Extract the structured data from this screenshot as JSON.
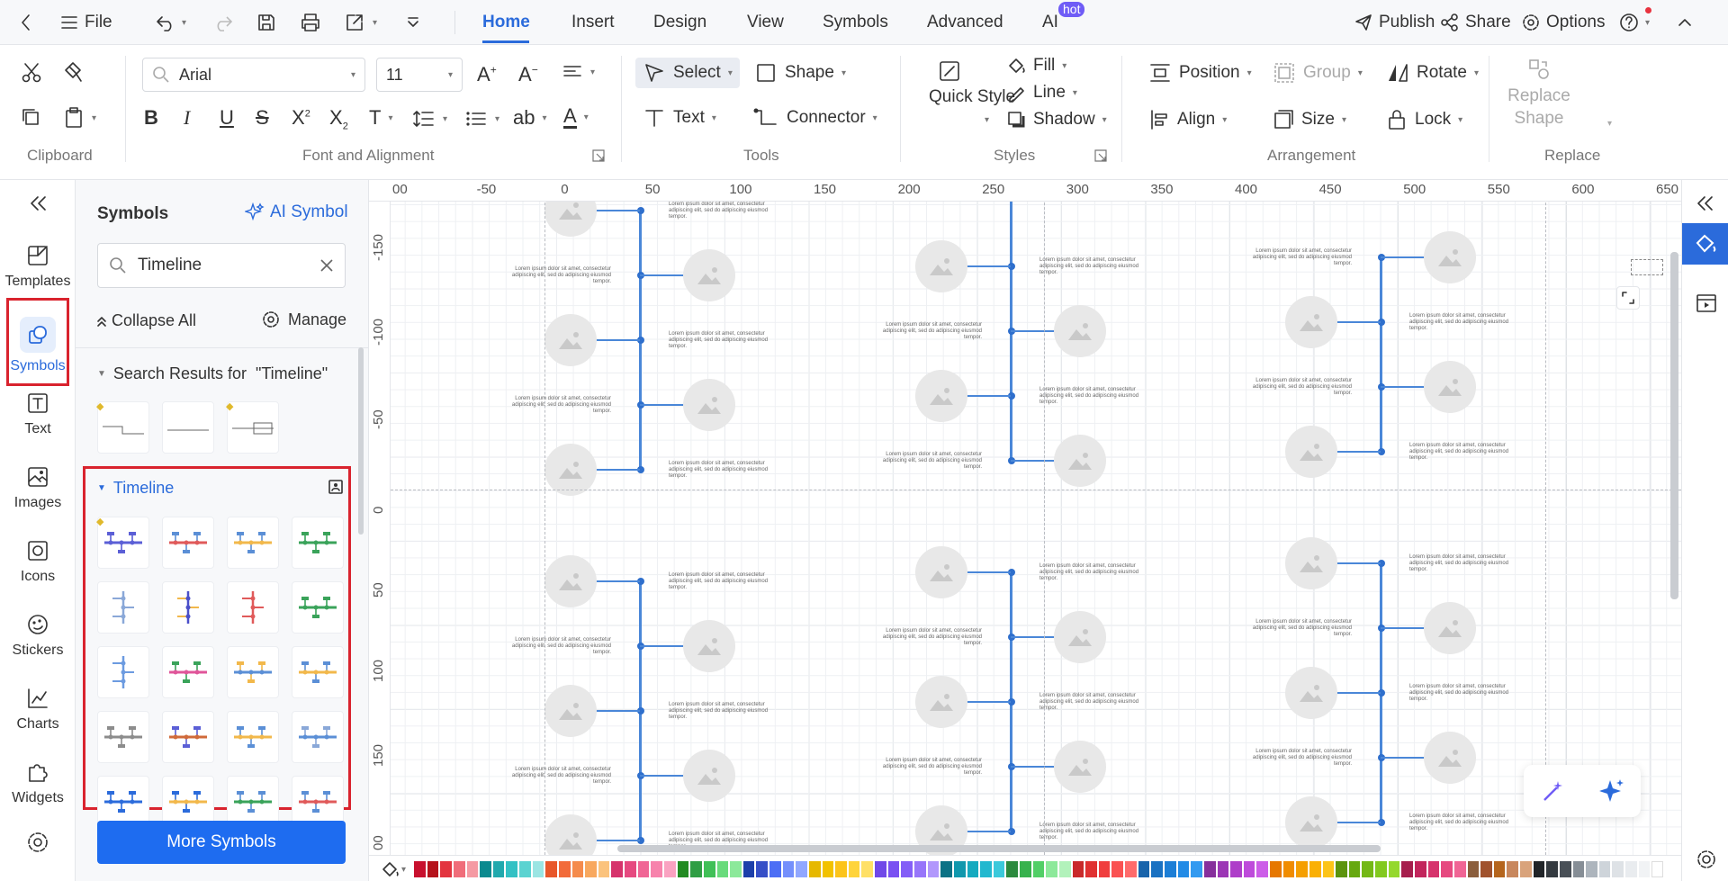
{
  "topbar": {
    "back_icon": "chevron-left-icon",
    "file_label": "File",
    "tabs": [
      "Home",
      "Insert",
      "Design",
      "View",
      "Symbols",
      "Advanced",
      "AI"
    ],
    "hot_badge": "hot",
    "publish_label": "Publish",
    "share_label": "Share",
    "options_label": "Options",
    "accent": "#2b6bdb"
  },
  "ribbon": {
    "font_name": "Arial",
    "font_size": "11",
    "select_label": "Select",
    "shape_label": "Shape",
    "text_label": "Text",
    "connector_label": "Connector",
    "quick_style_label": "Quick Style",
    "fill_label": "Fill",
    "line_label": "Line",
    "shadow_label": "Shadow",
    "position_label": "Position",
    "group_label": "Group",
    "rotate_label": "Rotate",
    "align_label": "Align",
    "size_label": "Size",
    "lock_label": "Lock",
    "replace_shape_label": "Replace Shape",
    "groups": {
      "clipboard": "Clipboard",
      "font": "Font and Alignment",
      "tools": "Tools",
      "styles": "Styles",
      "arrangement": "Arrangement",
      "replace": "Replace"
    }
  },
  "rail": {
    "items": [
      "Templates",
      "Symbols",
      "Text",
      "Images",
      "Icons",
      "Stickers",
      "Charts",
      "Widgets"
    ],
    "active": "Symbols"
  },
  "panel": {
    "title": "Symbols",
    "ai_symbol_label": "AI Symbol",
    "search_value": "Timeline",
    "collapse_label": "Collapse All",
    "manage_label": "Manage",
    "results_label": "Search Results for  \"Timeline\"",
    "timeline_label": "Timeline",
    "more_label": "More Symbols"
  },
  "canvas": {
    "ruler_x": [
      "00",
      "-50",
      "0",
      "50",
      "100",
      "150",
      "200",
      "250",
      "300",
      "350",
      "400",
      "450",
      "500",
      "550",
      "600",
      "650"
    ],
    "ruler_y": [
      "-150",
      "-100",
      "-50",
      "0",
      "50",
      "100",
      "150",
      "00"
    ],
    "lorem": "Lorem ipsum dolor sit amet, consectetur adipiscing elit, sed do adipiscing eiusmod tempor."
  },
  "palette": {
    "colors": [
      "#c8102e",
      "#b5121b",
      "#e3343f",
      "#f06d7a",
      "#f59aa3",
      "#0b8a8f",
      "#20a9ad",
      "#33c1c4",
      "#5bd3d1",
      "#9be5e3",
      "#e8572a",
      "#f26b3a",
      "#f58b4c",
      "#f8a85e",
      "#fbc37d",
      "#d6336c",
      "#e64980",
      "#f06595",
      "#f783ac",
      "#faa2c1",
      "#228b22",
      "#2f9e44",
      "#40c057",
      "#69db7c",
      "#8ce99a",
      "#1c3faa",
      "#364fc7",
      "#4c6ef5",
      "#748ffc",
      "#91a7ff",
      "#e6b800",
      "#f2c200",
      "#fcc419",
      "#ffd43b",
      "#ffe066",
      "#7048e8",
      "#7950f2",
      "#845ef7",
      "#9775fa",
      "#b197fc",
      "#0b7285",
      "#1098ad",
      "#15aabf",
      "#22b8cf",
      "#3bc9db",
      "#2b8a3e",
      "#37b24d",
      "#51cf66",
      "#8ce99a",
      "#b2f2bb",
      "#c92a2a",
      "#e03131",
      "#f03e3e",
      "#fa5252",
      "#ff6b6b",
      "#1864ab",
      "#1971c2",
      "#1c7ed6",
      "#228be6",
      "#339af0",
      "#862e9c",
      "#9c36b5",
      "#ae3ec9",
      "#be4bdb",
      "#cc5de8",
      "#e67700",
      "#f08c00",
      "#f59f00",
      "#fab005",
      "#fcc419",
      "#5c940d",
      "#66a80f",
      "#74b816",
      "#82c91e",
      "#94d82d",
      "#a61e4d",
      "#c2255c",
      "#d6336c",
      "#e64980",
      "#f06595",
      "#8b5e3c",
      "#a0522d",
      "#b5651d",
      "#c8875d",
      "#d9a37b",
      "#212529",
      "#343a40",
      "#495057",
      "#868e96",
      "#adb5bd",
      "#ced4da",
      "#dee2e6",
      "#e9ecef",
      "#f1f3f5",
      "#ffffff"
    ]
  }
}
